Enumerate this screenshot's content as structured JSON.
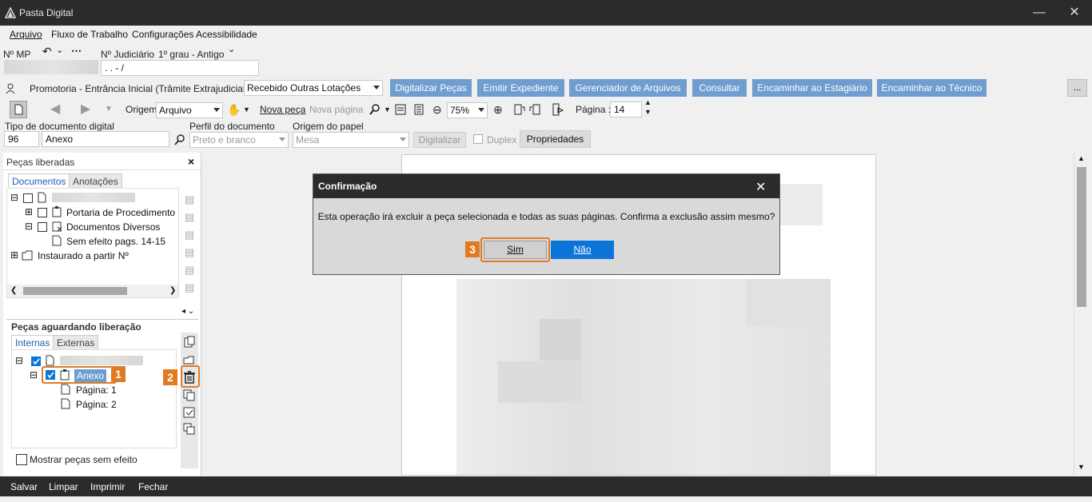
{
  "window": {
    "title": "Pasta Digital"
  },
  "menu": [
    "Arquivo",
    "Fluxo de Trabalho",
    "Configurações",
    "Acessibilidade"
  ],
  "header": {
    "mp_label": "Nº MP",
    "judicial_label": "Nº Judiciário",
    "judicial_grade": "1º grau - Antigo",
    "judicial_value": ". .     - /"
  },
  "prom": {
    "text": "Promotoria - Entrância Inicial (Trâmite Extrajudicial) - Fila",
    "queue": "Recebido Outras Lotações"
  },
  "actions": [
    "Digitalizar Peças",
    "Emitir Expediente",
    "Gerenciador de Arquivos",
    "Consultar",
    "Encaminhar ao Estagiário",
    "Encaminhar ao Técnico"
  ],
  "more": "...",
  "toolbar": {
    "origem_label": "Origem",
    "origem_value": "Arquivo",
    "nova_peca": "Nova peça",
    "nova_pagina": "Nova página",
    "zoom": "75%",
    "pagina_label": "Página :",
    "pagina_value": "14"
  },
  "docfields": {
    "tipo_label": "Tipo de documento digital",
    "tipo_code": "96",
    "tipo_value": "Anexo",
    "perfil_label": "Perfil do documento",
    "perfil_value": "Preto e branco",
    "origem_papel_label": "Origem do papel",
    "origem_papel_value": "Mesa",
    "digitalizar": "Digitalizar",
    "duplex": "Duplex",
    "propriedades": "Propriedades"
  },
  "left": {
    "title": "Peças liberadas",
    "close": "×",
    "tabs": [
      "Documentos",
      "Anotações"
    ],
    "tree": [
      "Portaria de Procedimento",
      "Documentos Diversos",
      "Sem efeito pags. 14-15",
      "Instaurado a partir Nº"
    ],
    "pending_title": "Peças aguardando liberação",
    "pending_tabs": [
      "Internas",
      "Externas"
    ],
    "pending_tree": [
      "Anexo",
      "Página: 1",
      "Página: 2"
    ],
    "show_void": "Mostrar peças sem efeito"
  },
  "dialog": {
    "title": "Confirmação",
    "message": "Esta operação irá excluir a peça selecionada e todas as suas páginas. Confirma a exclusão assim mesmo?",
    "yes": "Sim",
    "no": "Não"
  },
  "badges": {
    "b1": "1",
    "b2": "2",
    "b3": "3"
  },
  "bottom": [
    "Salvar",
    "Limpar",
    "Imprimir",
    "Fechar"
  ],
  "colors": {
    "accent": "#6f9dcf",
    "highlight": "#e07b24",
    "dark": "#2b2b2b",
    "primary_button": "#0a74d8"
  }
}
